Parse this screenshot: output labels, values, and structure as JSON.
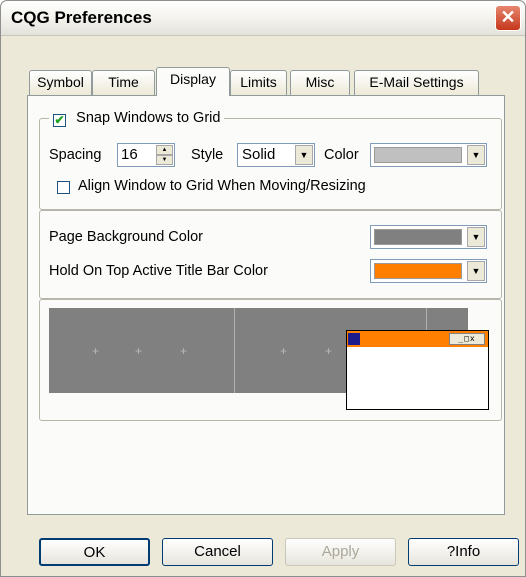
{
  "window": {
    "title": "CQG Preferences",
    "close_glyph": "✕"
  },
  "tabs": [
    {
      "label": "Symbol"
    },
    {
      "label": "Time"
    },
    {
      "label": "Display"
    },
    {
      "label": "Limits"
    },
    {
      "label": "Misc"
    },
    {
      "label": "E-Mail Settings"
    }
  ],
  "grid": {
    "snap_label": "Snap Windows to Grid",
    "snap_checked": true,
    "spacing_label": "Spacing",
    "spacing_value": "16",
    "style_label": "Style",
    "style_value": "Solid",
    "color_label": "Color",
    "color_value": "#c0c0c0",
    "align_label": "Align Window to Grid When Moving/Resizing",
    "align_checked": false
  },
  "colors": {
    "page_bg_label": "Page Background Color",
    "page_bg_value": "#808080",
    "hold_on_top_label": "Hold On Top Active Title Bar Color",
    "hold_on_top_value": "#ff8000"
  },
  "buttons": {
    "ok": "OK",
    "cancel": "Cancel",
    "apply": "Apply",
    "info": "?Info"
  },
  "glyphs": {
    "check": "✔",
    "dropdown": "▼",
    "spin_up": "▲",
    "spin_down": "▼",
    "plus": "+"
  }
}
